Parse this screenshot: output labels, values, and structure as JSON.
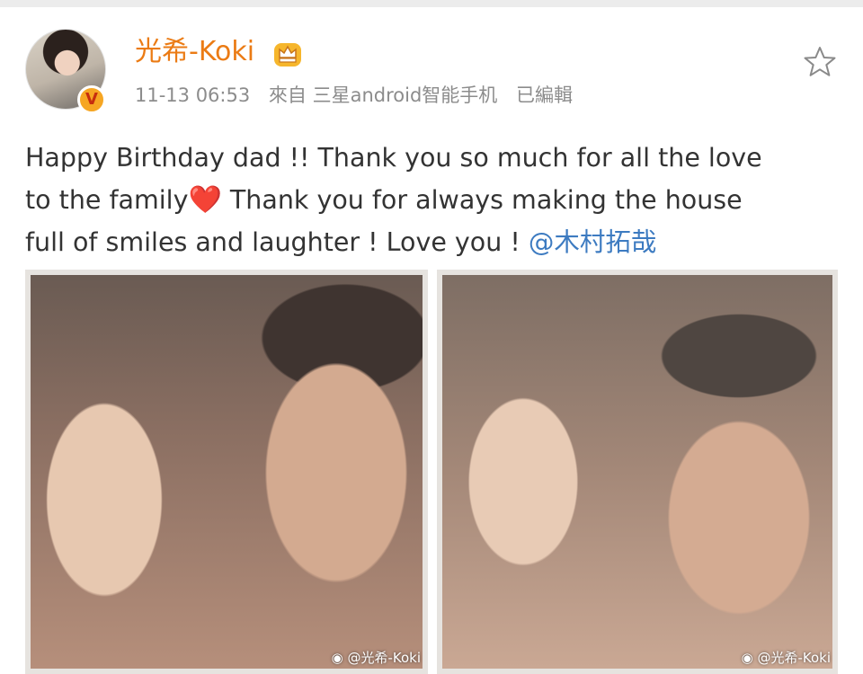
{
  "post": {
    "username": "光希-Koki",
    "verified_badge": "V",
    "timestamp": "11-13 06:53",
    "source": "來自 三星android智能手机",
    "edited": "已編輯",
    "content": {
      "line1": "Happy Birthday dad !!  Thank you so much for all the love",
      "line2_start": "to the family",
      "heart": "❤️",
      "line2_end": " Thank you for always making the house",
      "line3": "full of smiles and laughter ! Love you ! ",
      "mention": "@木村拓哉"
    },
    "photos": [
      {
        "watermark": "@光希-Koki"
      },
      {
        "watermark": "@光希-Koki"
      }
    ]
  },
  "icons": {
    "star": "star-outline-icon",
    "crown": "crown-icon"
  },
  "colors": {
    "username": "#eb7b14",
    "meta": "#8c8c8c",
    "mention": "#3d7bc1",
    "heart": "#e6262c"
  }
}
